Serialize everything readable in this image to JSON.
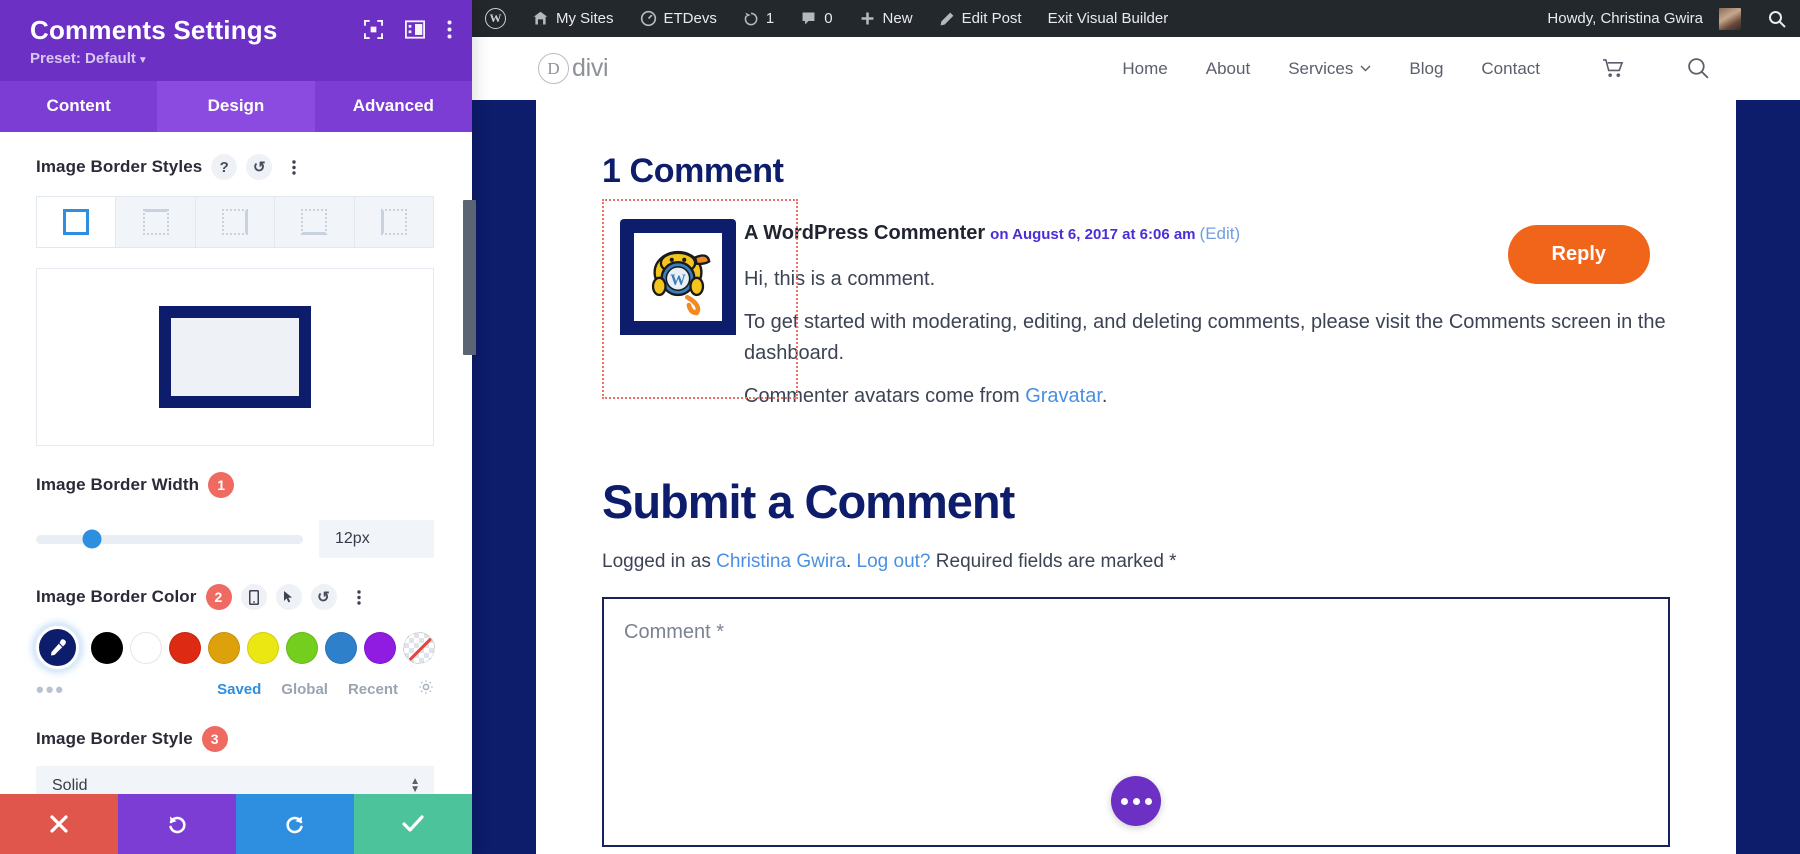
{
  "settings_panel": {
    "title": "Comments Settings",
    "preset_label": "Preset: Default",
    "header_icons": [
      "focus-icon",
      "layout-panel-icon",
      "more-vertical-icon"
    ],
    "tabs": [
      {
        "label": "Content",
        "active": false
      },
      {
        "label": "Design",
        "active": true
      },
      {
        "label": "Advanced",
        "active": false
      }
    ],
    "border_styles_section": {
      "label": "Image Border Styles",
      "help_icon": "question-icon",
      "reset_icon": "undo-icon",
      "more_icon": "more-vertical-icon",
      "options": [
        "all-sides",
        "top-side",
        "right-side",
        "bottom-side",
        "left-side"
      ],
      "selected_index": 0
    },
    "border_width": {
      "label": "Image Border Width",
      "badge": "1",
      "value": "12px",
      "slider_percent": 25
    },
    "border_color": {
      "label": "Image Border Color",
      "badge": "2",
      "icons": [
        "mobile-icon",
        "cursor-icon",
        "undo-icon",
        "more-vertical-icon"
      ],
      "current_color": "#0d1c6b",
      "swatches": [
        "#000000",
        "#ffffff",
        "#dc2a13",
        "#dda10c",
        "#eae712",
        "#74ce1d",
        "#2e80cb",
        "#8f1ce0"
      ],
      "no_color_label": "transparent",
      "more_dots": "•••",
      "links": [
        {
          "label": "Saved",
          "active": true
        },
        {
          "label": "Global",
          "active": false
        },
        {
          "label": "Recent",
          "active": false
        }
      ],
      "settings_icon": "gear-icon"
    },
    "border_style": {
      "label": "Image Border Style",
      "badge": "3",
      "value": "Solid"
    },
    "actions": [
      {
        "name": "cancel",
        "icon": "✕"
      },
      {
        "name": "undo",
        "icon": "↺"
      },
      {
        "name": "redo",
        "icon": "↻"
      },
      {
        "name": "save",
        "icon": "✓"
      }
    ]
  },
  "admin_bar": {
    "wp_logo": "wordpress-icon",
    "items": [
      {
        "label": "My Sites",
        "icon": "sites-icon"
      },
      {
        "label": "ETDevs",
        "icon": "dashboard-icon"
      },
      {
        "label": "1",
        "icon": "updates-icon"
      },
      {
        "label": "0",
        "icon": "comment-bubble-icon"
      },
      {
        "label": "New",
        "icon": "plus-icon"
      },
      {
        "label": "Edit Post",
        "icon": "pencil-icon"
      },
      {
        "label": "Exit Visual Builder",
        "icon": ""
      }
    ],
    "howdy": "Howdy, Christina Gwira",
    "search_icon": "search-icon"
  },
  "site_header": {
    "logo_mark": "D",
    "logo_word": "divi",
    "nav": [
      {
        "label": "Home",
        "has_caret": false
      },
      {
        "label": "About",
        "has_caret": false
      },
      {
        "label": "Services",
        "has_caret": true
      },
      {
        "label": "Blog",
        "has_caret": false
      },
      {
        "label": "Contact",
        "has_caret": false
      }
    ],
    "cart_icon": "cart-icon",
    "search_icon": "search-icon"
  },
  "comments": {
    "heading": "1 Comment",
    "author": "A WordPress Commenter",
    "date": "on August 6, 2017 at 6:06 am",
    "edit_label": "(Edit)",
    "avatar_alt": "wapuu-avatar",
    "lines": [
      "Hi, this is a comment.",
      "To get started with moderating, editing, and deleting comments, please visit the Comments screen in the dashboard.",
      "Commenter avatars come from "
    ],
    "gravatar_link": "Gravatar",
    "gravatar_suffix": ".",
    "reply_label": "Reply",
    "reply_color": "#f1651b"
  },
  "submit_form": {
    "heading": "Submit a Comment",
    "logged_in_prefix": "Logged in as ",
    "logged_in_name": "Christina Gwira",
    "logged_in_mid": ". ",
    "logout_label": "Log out?",
    "required_note": " Required fields are marked *",
    "comment_placeholder": "Comment *"
  },
  "floating_button": {
    "name": "divi-builder-menu",
    "icon": "ellipsis-icon",
    "color": "#6d30c4"
  }
}
